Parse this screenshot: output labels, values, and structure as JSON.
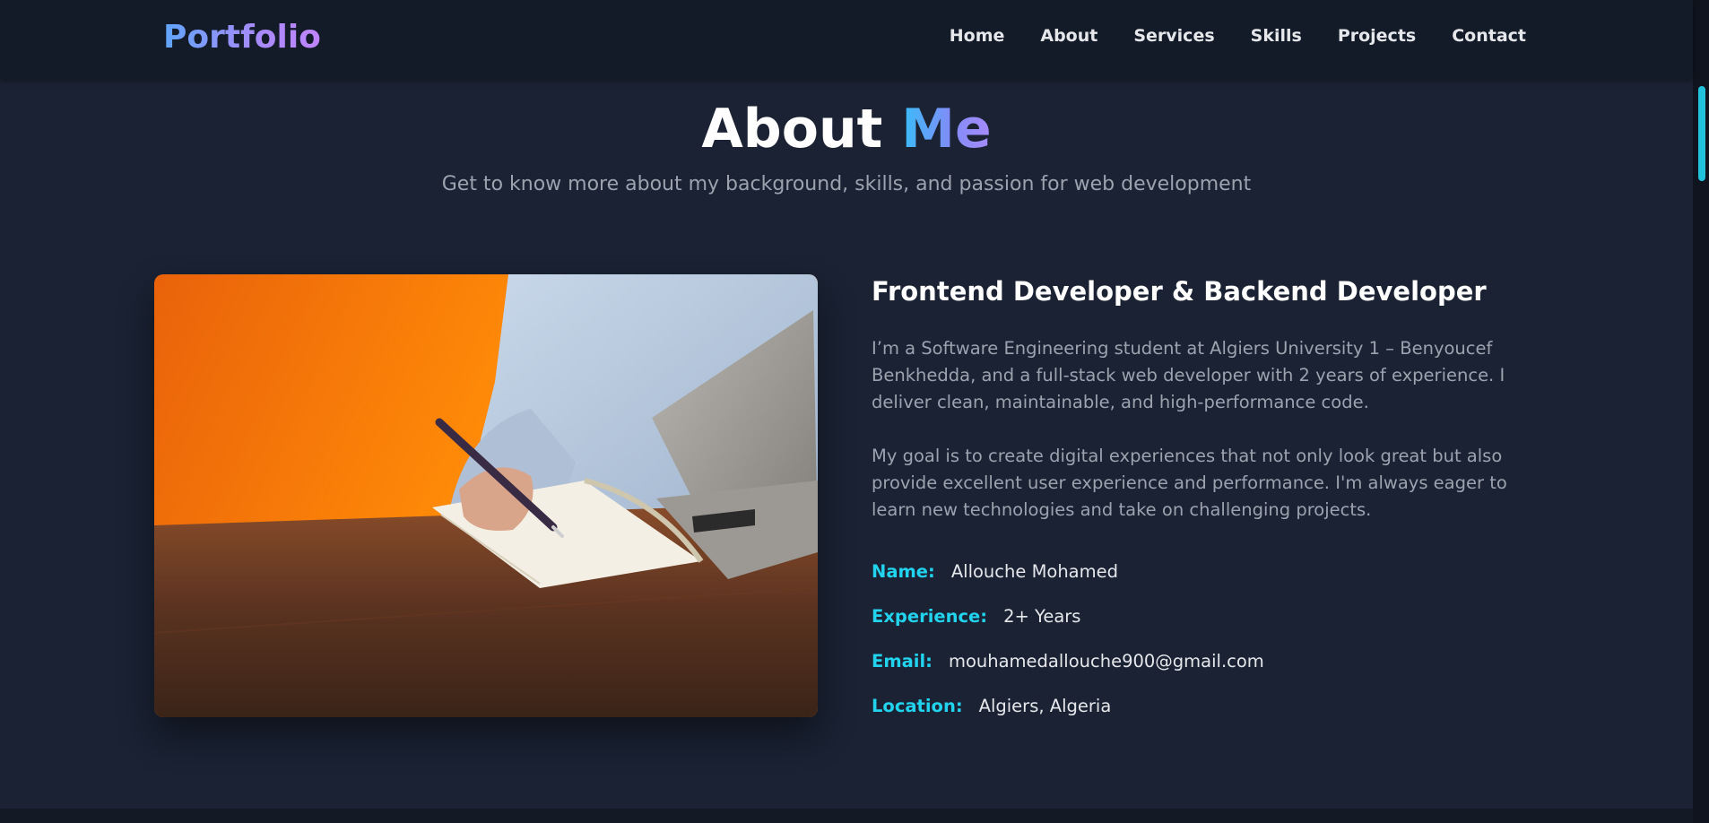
{
  "brand": {
    "logo_text": "Portfolio",
    "accent": "#22d3ee"
  },
  "nav": {
    "items": [
      "Home",
      "About",
      "Services",
      "Skills",
      "Projects",
      "Contact"
    ]
  },
  "section": {
    "title_main": "About",
    "title_accent": "Me",
    "subtitle": "Get to know more about my background, skills, and passion for web development"
  },
  "photo": {
    "description_icon": "person-writing-notebook-image"
  },
  "about": {
    "role": "Frontend Developer & Backend Developer",
    "paragraph1": "I’m a Software Engineering student at Algiers University 1 – Benyoucef Benkhedda, and a full-stack web developer with 2 years of experience. I deliver clean, maintainable, and high-performance code.",
    "paragraph2": "My goal is to create digital experiences that not only look great but also provide excellent user experience and performance. I'm always eager to learn new technologies and take on challenging projects.",
    "info": [
      {
        "label": "Name:",
        "value": "Allouche Mohamed"
      },
      {
        "label": "Experience:",
        "value": "2+ Years"
      },
      {
        "label": "Email:",
        "value": "mouhamedallouche900@gmail.com"
      },
      {
        "label": "Location:",
        "value": "Algiers, Algeria"
      }
    ]
  }
}
